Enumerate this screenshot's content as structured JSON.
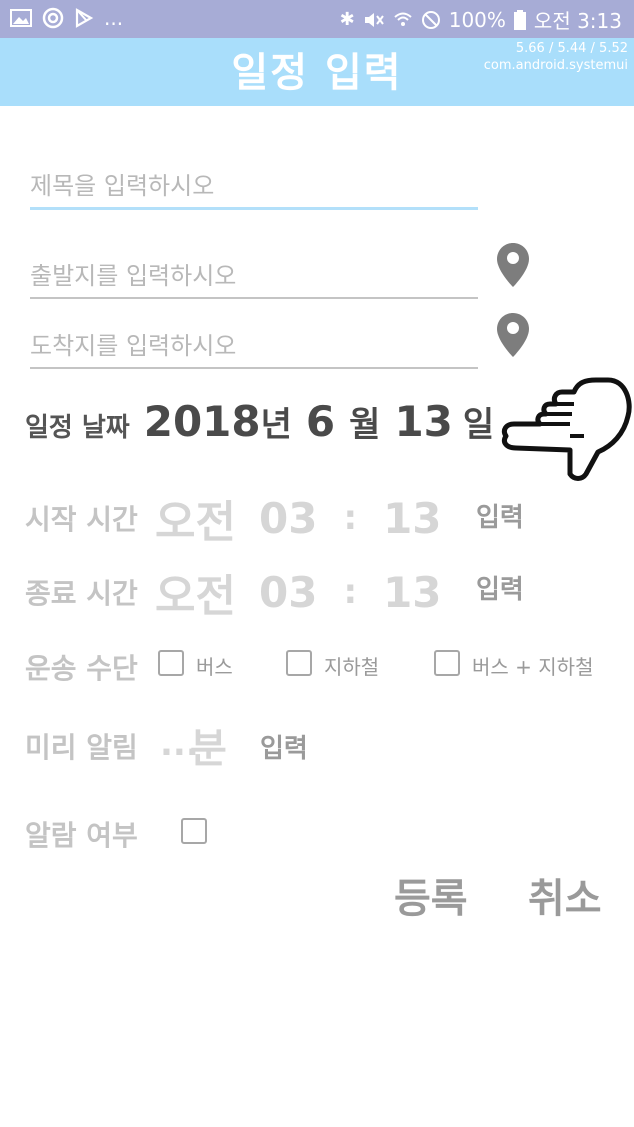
{
  "status_bar": {
    "left_ellipsis": "...",
    "battery": "100%",
    "time": "오전 3:13"
  },
  "header": {
    "title": "일정 입력",
    "debug_line1": "5.66 / 5.44 / 5.52",
    "debug_line2": "com.android.systemui"
  },
  "form": {
    "title_placeholder": "제목을 입력하시오",
    "departure_placeholder": "출발지를 입력하시오",
    "arrival_placeholder": "도착지를 입력하시오"
  },
  "date": {
    "label": "일정 날짜",
    "year": "2018",
    "year_unit": "년",
    "month": "6",
    "month_unit": "월",
    "day": "13",
    "day_unit": "일"
  },
  "start_time": {
    "label": "시작 시간",
    "ampm": "오전",
    "hour": "03",
    "sep": ":",
    "minute": "13",
    "button": "입력"
  },
  "end_time": {
    "label": "종료 시간",
    "ampm": "오전",
    "hour": "03",
    "sep": ":",
    "minute": "13",
    "button": "입력"
  },
  "transport": {
    "label": "운송 수단",
    "options": [
      "버스",
      "지하철",
      "버스 + 지하철"
    ]
  },
  "reminder": {
    "label": "미리 알림",
    "value": "...",
    "unit": "분",
    "button": "입력"
  },
  "alarm": {
    "label": "알람 여부"
  },
  "actions": {
    "register": "등록",
    "cancel": "취소"
  },
  "colors": {
    "status_bar": "#a7acd6",
    "app_bar": "#a9defb",
    "accent_underline": "#b3e0fa"
  }
}
